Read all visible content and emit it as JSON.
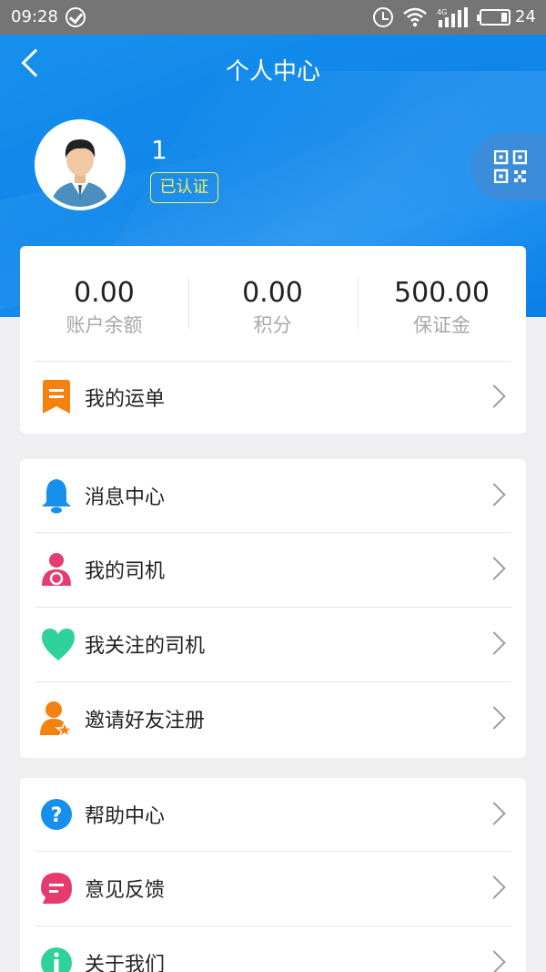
{
  "status_bar": {
    "time": "09:28",
    "network": "4G",
    "battery": "24"
  },
  "header": {
    "title": "个人中心",
    "username": "1",
    "verified_badge": "已认证"
  },
  "stats": [
    {
      "value": "0.00",
      "label": "账户余额"
    },
    {
      "value": "0.00",
      "label": "积分"
    },
    {
      "value": "500.00",
      "label": "保证金"
    }
  ],
  "menu_orders": {
    "label": "我的运单",
    "icon": "waybill-icon"
  },
  "menu_group1": [
    {
      "label": "消息中心",
      "icon": "bell-icon"
    },
    {
      "label": "我的司机",
      "icon": "driver-icon"
    },
    {
      "label": "我关注的司机",
      "icon": "heart-icon"
    },
    {
      "label": "邀请好友注册",
      "icon": "invite-icon"
    }
  ],
  "menu_group2": [
    {
      "label": "帮助中心",
      "icon": "help-icon"
    },
    {
      "label": "意见反馈",
      "icon": "feedback-icon"
    },
    {
      "label": "关于我们",
      "icon": "info-icon"
    }
  ],
  "colors": {
    "header_blue": "#1790ec",
    "orange": "#f5820f",
    "blue": "#1790ec",
    "pink": "#e63b6e",
    "green": "#2fd29b",
    "badge_yellow": "#f1f34a"
  }
}
